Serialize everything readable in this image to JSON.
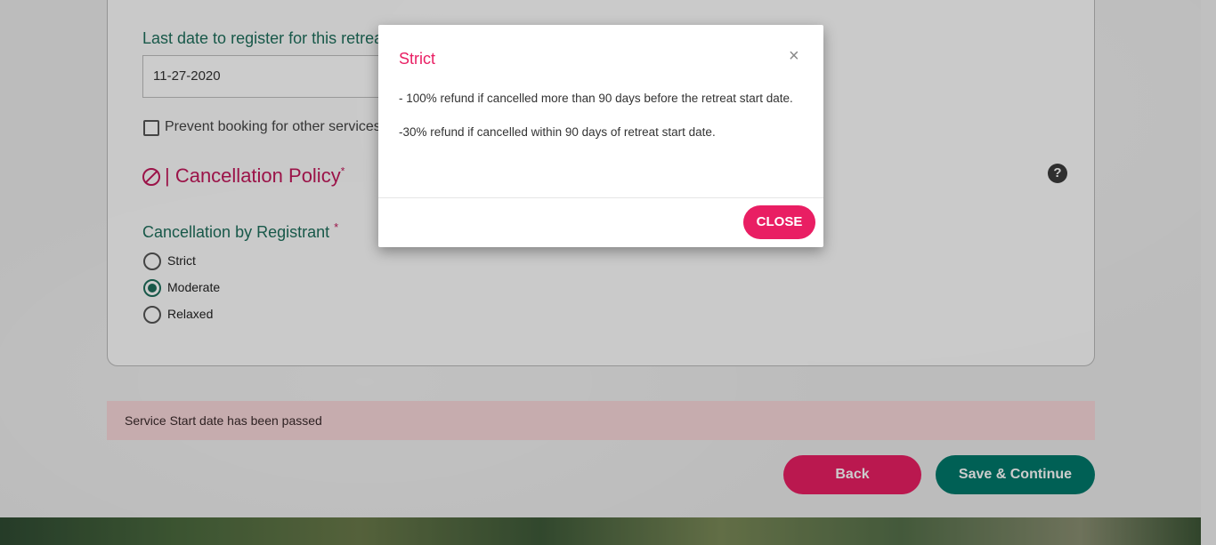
{
  "form": {
    "register_label": "Last date to register for this retreat",
    "register_value": "11-27-2020",
    "prevent_label": "Prevent booking for other services",
    "policy_title": "| Cancellation Policy",
    "required_mark": "*",
    "registrant_label": "Cancellation by Registrant",
    "options": [
      "Strict",
      "Moderate",
      "Relaxed"
    ],
    "selected": "Moderate"
  },
  "alert": {
    "text": "Service Start date has been passed"
  },
  "actions": {
    "back": "Back",
    "save": "Save & Continue"
  },
  "modal": {
    "title": "Strict",
    "close_x": "×",
    "line1": "- 100% refund if cancelled more than 90 days before the retreat start date.",
    "line2": "-30% refund if cancelled within 90 days of retreat start date.",
    "close_label": "CLOSE"
  },
  "icons": {
    "help": "?"
  },
  "colors": {
    "green": "#1e6f5c",
    "pink": "#e91e63",
    "alert_bg": "#f8d7da"
  }
}
